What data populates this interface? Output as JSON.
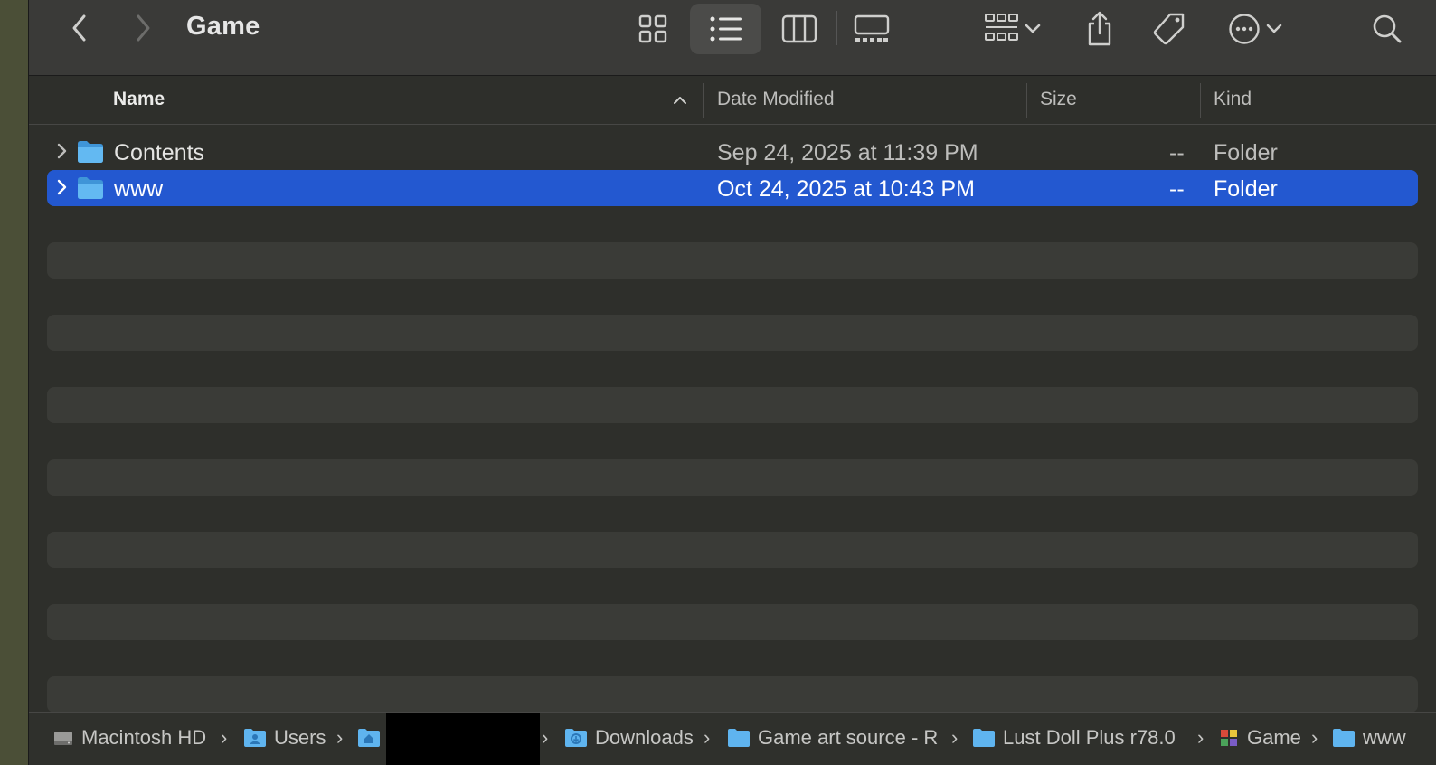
{
  "window": {
    "title": "Game"
  },
  "toolbar": {
    "back_icon": "chevron-left-icon",
    "forward_icon": "chevron-right-icon",
    "views": [
      "icon-view",
      "list-view",
      "column-view",
      "gallery-view"
    ],
    "active_view": "list-view",
    "group_icon": "group-by-icon",
    "share_icon": "share-icon",
    "tag_icon": "tag-icon",
    "more_icon": "ellipsis-circle-icon",
    "search_icon": "search-icon"
  },
  "columns": {
    "name": "Name",
    "date": "Date Modified",
    "size": "Size",
    "kind": "Kind"
  },
  "files": [
    {
      "name": "Contents",
      "date": "Sep 24, 2025 at 11:39 PM",
      "size": "--",
      "kind": "Folder",
      "selected": false
    },
    {
      "name": "www",
      "date": "Oct 24, 2025 at 10:43 PM",
      "size": "--",
      "kind": "Folder",
      "selected": true
    }
  ],
  "path": [
    {
      "label": "Macintosh HD",
      "icon": "hard-drive-icon"
    },
    {
      "label": "Users",
      "icon": "users-folder-icon"
    },
    {
      "label": "",
      "icon": "home-folder-icon"
    },
    {
      "label": "Downloads",
      "icon": "downloads-folder-icon"
    },
    {
      "label": "Game art source - R",
      "icon": "folder-icon"
    },
    {
      "label": "Lust Doll Plus r78.0",
      "icon": "folder-icon"
    },
    {
      "label": "Game",
      "icon": "game-app-icon"
    },
    {
      "label": "www",
      "icon": "folder-icon"
    }
  ],
  "colors": {
    "selection": "#2358d0",
    "folder": "#5fb4ef",
    "window_bg": "#2e2f2b",
    "toolbar_bg": "#3a3a38"
  }
}
